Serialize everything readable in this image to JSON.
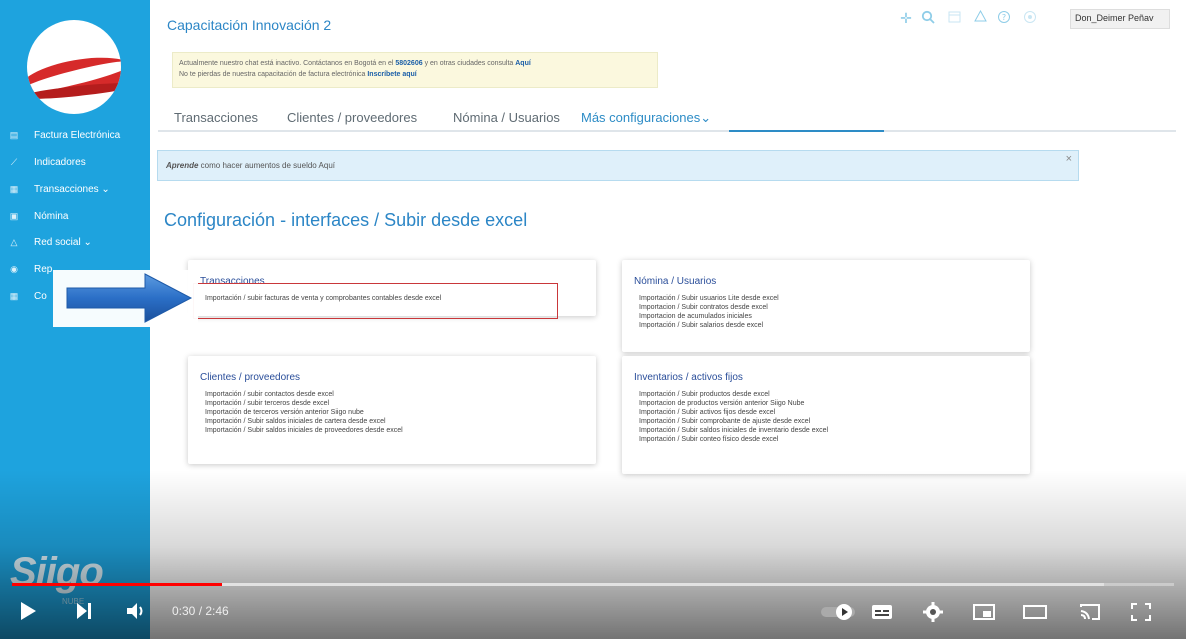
{
  "app": {
    "title": "Capacitación Innovación 2",
    "user_label": "Don_Deimer Peña",
    "user_chevron": "v"
  },
  "notice": {
    "line1_prefix": "Actualmente nuestro chat está inactivo. Contáctanos en Bogotá en el ",
    "phone": "5802606",
    "line1_mid": " y en otras ciudades consulta ",
    "line1_link": "Aquí",
    "line2_prefix": "No te pierdas de nuestra capacitación de factura electrónica ",
    "line2_link": "Inscríbete aquí"
  },
  "sidebar": {
    "items": [
      {
        "label": "Factura Electrónica"
      },
      {
        "label": "Indicadores"
      },
      {
        "label": "Transacciones ⌄"
      },
      {
        "label": "Nómina"
      },
      {
        "label": "Red social ⌄"
      },
      {
        "label": "Rep"
      },
      {
        "label": "Co"
      }
    ],
    "brand": "Siigo",
    "brand_sub": "NUBE"
  },
  "tabs": [
    {
      "label": "Transacciones"
    },
    {
      "label": "Clientes / proveedores"
    },
    {
      "label": "Nómina / Usuarios"
    },
    {
      "label": "Más configuraciones⌄"
    }
  ],
  "info_bar": {
    "strong": "Aprende",
    "text": " como hacer aumentos de sueldo Aquí",
    "close": "×"
  },
  "page_title": "Configuración - interfaces / Subir desde excel",
  "cards": {
    "transacciones": {
      "title": "Transacciones",
      "items": [
        "Importación / subir facturas de venta y comprobantes contables desde excel"
      ]
    },
    "nomina": {
      "title": "Nómina / Usuarios",
      "items": [
        "Importación / Subir usuarios Lite desde excel",
        "Importacion / Subir contratos desde excel",
        "Importacion de acumulados iniciales",
        "Importación / Subir salarios desde excel"
      ]
    },
    "clientes": {
      "title": "Clientes / proveedores",
      "items": [
        "Importación / subir contactos desde excel",
        "Importación / subir terceros desde excel",
        "Importación de terceros versión anterior Siigo nube",
        "Importación / Subir saldos iniciales de cartera desde excel",
        "Importación / Subir saldos iniciales de proveedores desde excel"
      ]
    },
    "inventarios": {
      "title": "Inventarios / activos fijos",
      "items": [
        "Importación / Subir productos desde excel",
        "Importacion de productos versión anterior Siigo Nube",
        "Importación / Subir activos fijos desde excel",
        "Importación / Subir comprobante de ajuste desde excel",
        "Importación / Subir saldos iniciales de inventario desde excel",
        "Importación / Subir conteo físico desde excel"
      ]
    }
  },
  "player": {
    "time": "0:30 / 2:46",
    "progress_fraction": 0.181,
    "buffer_fraction": 0.94
  },
  "colors": {
    "sidebar": "#1ea3de",
    "accent": "#2c86c6",
    "card_title": "#2a4e9a",
    "highlight": "#c9373a",
    "progress": "#ff0000",
    "arrow": "#2b6fc7"
  }
}
